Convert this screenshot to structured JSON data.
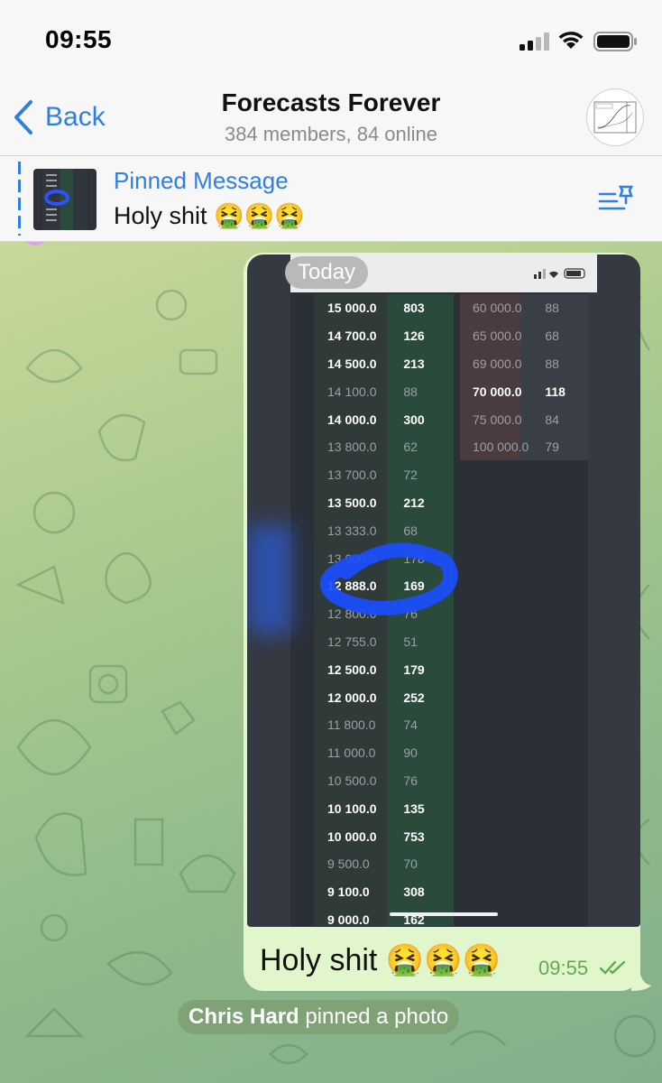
{
  "status": {
    "time": "09:55"
  },
  "header": {
    "back_label": "Back",
    "title": "Forecasts Forever",
    "subtitle": "384 members, 84 online"
  },
  "pinned": {
    "title": "Pinned Message",
    "text": "Holy shit 🤮🤮🤮"
  },
  "message": {
    "date_badge": "Today",
    "text": "Holy shit 🤮🤮🤮",
    "time": "09:55"
  },
  "service": {
    "user": "Chris Hard",
    "action": " pinned a photo"
  },
  "orderbook": {
    "bids": [
      {
        "price": "15 000.0",
        "qty": "803",
        "bold": true
      },
      {
        "price": "14 700.0",
        "qty": "126",
        "bold": true
      },
      {
        "price": "14 500.0",
        "qty": "213",
        "bold": true
      },
      {
        "price": "14 100.0",
        "qty": "88",
        "bold": false
      },
      {
        "price": "14 000.0",
        "qty": "300",
        "bold": true
      },
      {
        "price": "13 800.0",
        "qty": "62",
        "bold": false
      },
      {
        "price": "13 700.0",
        "qty": "72",
        "bold": false
      },
      {
        "price": "13 500.0",
        "qty": "212",
        "bold": true
      },
      {
        "price": "13 333.0",
        "qty": "68",
        "bold": false
      },
      {
        "price": "13 000.0",
        "qty": "178",
        "bold": false
      },
      {
        "price": "12 888.0",
        "qty": "169",
        "bold": true
      },
      {
        "price": "12 800.0",
        "qty": "76",
        "bold": false
      },
      {
        "price": "12 755.0",
        "qty": "51",
        "bold": false
      },
      {
        "price": "12 500.0",
        "qty": "179",
        "bold": true
      },
      {
        "price": "12 000.0",
        "qty": "252",
        "bold": true
      },
      {
        "price": "11 800.0",
        "qty": "74",
        "bold": false
      },
      {
        "price": "11 000.0",
        "qty": "90",
        "bold": false
      },
      {
        "price": "10 500.0",
        "qty": "76",
        "bold": false
      },
      {
        "price": "10 100.0",
        "qty": "135",
        "bold": true
      },
      {
        "price": "10 000.0",
        "qty": "753",
        "bold": true
      },
      {
        "price": "9 500.0",
        "qty": "70",
        "bold": false
      },
      {
        "price": "9 100.0",
        "qty": "308",
        "bold": true
      },
      {
        "price": "9 000.0",
        "qty": "162",
        "bold": true
      }
    ],
    "asks": [
      {
        "price": "60 000.0",
        "qty": "88",
        "bold": false
      },
      {
        "price": "65 000.0",
        "qty": "68",
        "bold": false
      },
      {
        "price": "69 000.0",
        "qty": "88",
        "bold": false
      },
      {
        "price": "70 000.0",
        "qty": "118",
        "bold": true
      },
      {
        "price": "75 000.0",
        "qty": "84",
        "bold": false
      },
      {
        "price": "100 000.0",
        "qty": "79",
        "bold": false
      }
    ]
  },
  "colors": {
    "accent": "#2f7fe0",
    "bubble": "#e1f7cb",
    "time_green": "#5fa94e"
  },
  "icons": {
    "back": "chevron-left-icon",
    "pin_list": "pin-list-icon",
    "read": "double-check-icon",
    "signal": "cellular-signal-icon",
    "wifi": "wifi-icon",
    "battery": "battery-icon"
  }
}
